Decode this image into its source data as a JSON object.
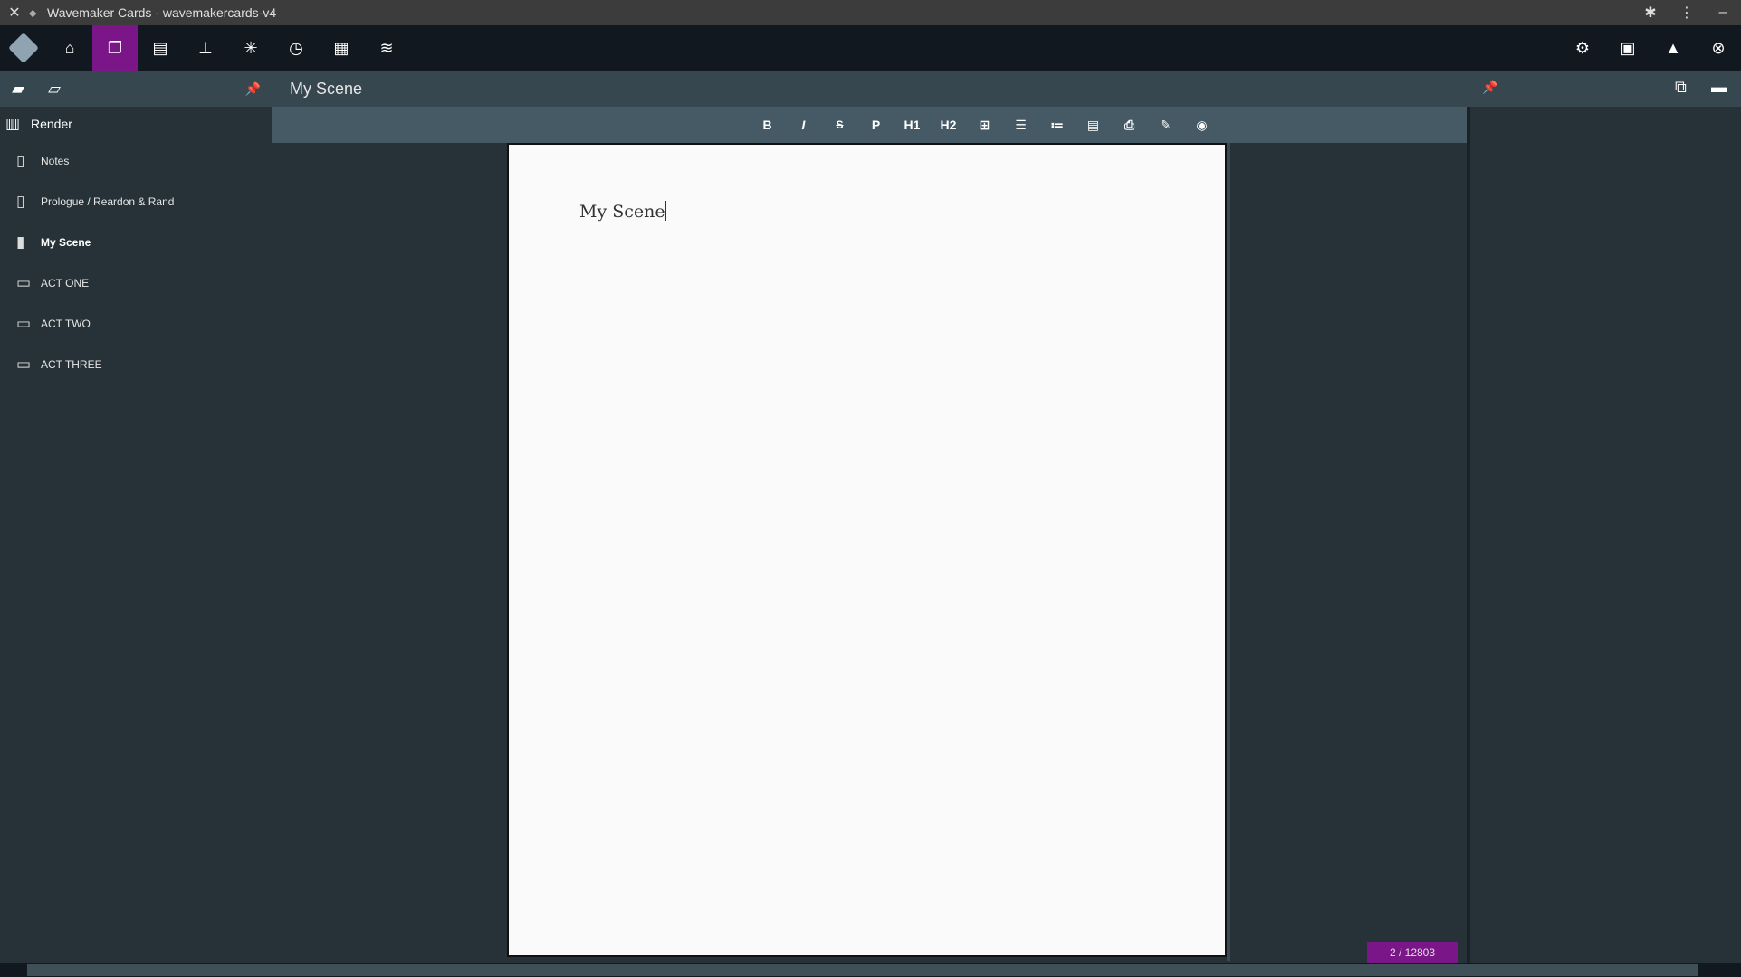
{
  "window": {
    "title": "Wavemaker Cards - wavemakercards-v4",
    "close_glyph": "✕",
    "favicon_glyph": "◆",
    "extensions_glyph": "✱",
    "menu_glyph": "⋮",
    "minimize_glyph": "–"
  },
  "topbar": {
    "nav": [
      {
        "icon": "home-icon",
        "glyph": "⌂"
      },
      {
        "icon": "book-open-icon",
        "glyph": "❐",
        "active": true
      },
      {
        "icon": "cards-icon",
        "glyph": "▤"
      },
      {
        "icon": "sitemap-icon",
        "glyph": "⊥"
      },
      {
        "icon": "asterisk-icon",
        "glyph": "✳"
      },
      {
        "icon": "alarm-clock-icon",
        "glyph": "◷"
      },
      {
        "icon": "table-icon",
        "glyph": "▦"
      },
      {
        "icon": "database-icon",
        "glyph": "≋"
      }
    ],
    "right": [
      {
        "icon": "gear-icon",
        "glyph": "⚙"
      },
      {
        "icon": "save-icon",
        "glyph": "▣"
      },
      {
        "icon": "google-drive-icon",
        "glyph": "▲"
      },
      {
        "icon": "close-circle-icon",
        "glyph": "⊗"
      }
    ]
  },
  "sidebar": {
    "tools": {
      "new_folder_glyph": "▰",
      "new_doc_glyph": "▱",
      "pin_glyph": "📌"
    },
    "render_label": "Render",
    "render_glyph": "▥",
    "items": [
      {
        "label": "Notes",
        "icon": "document-icon",
        "glyph": "▯"
      },
      {
        "label": "Prologue / Reardon & Rand",
        "icon": "document-icon",
        "glyph": "▯"
      },
      {
        "label": "My Scene",
        "icon": "document-filled-icon",
        "glyph": "▮",
        "selected": true
      },
      {
        "label": "ACT ONE",
        "icon": "folder-icon",
        "glyph": "▭"
      },
      {
        "label": "ACT TWO",
        "icon": "folder-icon",
        "glyph": "▭"
      },
      {
        "label": "ACT THREE",
        "icon": "folder-icon",
        "glyph": "▭"
      }
    ]
  },
  "main": {
    "doc_title": "My Scene",
    "pin_glyph": "📌",
    "open_external_glyph": "⧉",
    "add_card_glyph": "▬",
    "toolbar": [
      "B",
      "I",
      "S",
      "P",
      "H1",
      "H2",
      "⊞",
      "☰",
      "≔",
      "▤",
      "⎙",
      "✎",
      "◉"
    ],
    "page_text": "My Scene",
    "counter": "2 / 12803"
  }
}
